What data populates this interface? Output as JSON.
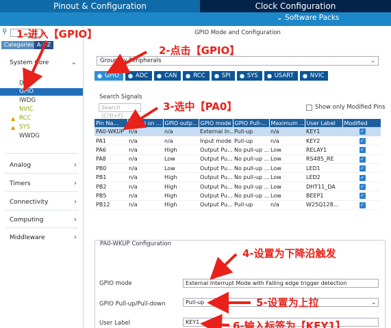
{
  "top_tabs": {
    "pinout": "Pinout & Configuration",
    "clock": "Clock Configuration"
  },
  "subbar": {
    "software_packs": "Software Packs"
  },
  "left": {
    "search_placeholder": "",
    "categories": "Categories",
    "az": "A->Z",
    "groups": [
      "System Core",
      "Analog",
      "Timers",
      "Connectivity",
      "Computing",
      "Middleware"
    ],
    "system_items": [
      "DMA",
      "GPIO",
      "IWDG",
      "NVIC",
      "RCC",
      "SYS",
      "WWDG"
    ]
  },
  "main": {
    "title": "GPIO Mode and Configuration",
    "group_by": "Group By Peripherals",
    "tabs": [
      "GPIO",
      "ADC",
      "CAN",
      "RCC",
      "SPI",
      "SYS",
      "USART",
      "NVIC"
    ],
    "search_signals": "Search Signals",
    "search_placeholder": "Search (Crtl+F)",
    "show_modified": "Show only Modified Pins",
    "columns": [
      "Pin Na...",
      "Signal on ...",
      "GPIO outp...",
      "GPIO mode",
      "GPIO Pull-...",
      "Maximum ...",
      "User Label",
      "Modified"
    ],
    "rows": [
      [
        "PA0-WKUP",
        "n/a",
        "n/a",
        "External In...",
        "Pull-up",
        "n/a",
        "KEY1"
      ],
      [
        "PA1",
        "n/a",
        "n/a",
        "Input mode",
        "Pull-up",
        "n/a",
        "KEY2"
      ],
      [
        "PA6",
        "n/a",
        "High",
        "Output Pu...",
        "No pull-up ...",
        "Low",
        "RELAY1"
      ],
      [
        "PA8",
        "n/a",
        "Low",
        "Output Pu...",
        "No pull-up ...",
        "Low",
        "RS485_RE"
      ],
      [
        "PB0",
        "n/a",
        "Low",
        "Output Pu...",
        "No pull-up ...",
        "Low",
        "LED1"
      ],
      [
        "PB1",
        "n/a",
        "High",
        "Output Pu...",
        "No pull-up ...",
        "Low",
        "LED2"
      ],
      [
        "PB2",
        "n/a",
        "High",
        "Output Pu...",
        "No pull-up ...",
        "Low",
        "DHT11_DA"
      ],
      [
        "PB5",
        "n/a",
        "High",
        "Output Pu...",
        "No pull-up ...",
        "Low",
        "BEEP1"
      ],
      [
        "PB12",
        "n/a",
        "High",
        "Output Pu...",
        "Pull-up",
        "n/a",
        "W25Q128..."
      ]
    ],
    "config": {
      "title": "PA0-WKUP Configuration",
      "gpio_mode_label": "GPIO mode",
      "gpio_mode_value": "External Interrupt Mode with Falling edge trigger detection",
      "pull_label": "GPIO Pull-up/Pull-down",
      "pull_value": "Pull-up",
      "user_label_label": "User Label",
      "user_label_value": "KEY1"
    }
  },
  "annotations": {
    "a1": "1-进入【GPIO】",
    "a2": "2-点击【GPIO】",
    "a3": "3-选中【PA0】",
    "a4": "4-设置为下降沿触发",
    "a5": "5-设置为上拉",
    "a6": "6-输入标签为【KEY1】"
  },
  "colors": {
    "annotation": "#e8221a",
    "header_blue": "#0e6aa8",
    "dark_blue": "#03234b",
    "accent": "#1d87c7"
  }
}
